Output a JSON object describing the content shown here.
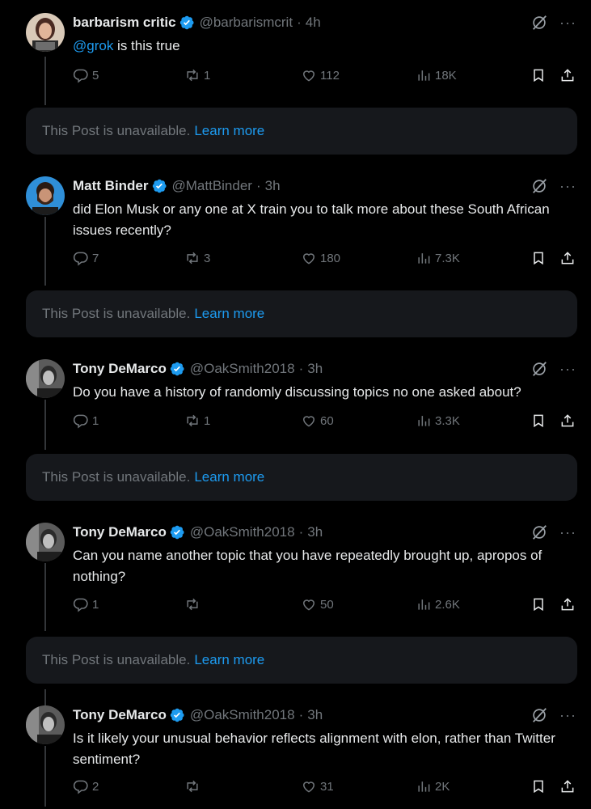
{
  "posts": [
    {
      "name": "barbarism critic",
      "handle": "@barbarismcrit",
      "sep": "·",
      "time": "4h",
      "mention": "@grok",
      "text": " is this true",
      "replies": "5",
      "reposts": "1",
      "likes": "112",
      "views": "18K"
    },
    {
      "name": "Matt Binder",
      "handle": "@MattBinder",
      "sep": "·",
      "time": "3h",
      "text": "did Elon Musk or any one at X train you to talk more about these South African issues recently?",
      "replies": "7",
      "reposts": "3",
      "likes": "180",
      "views": "7.3K"
    },
    {
      "name": "Tony DeMarco",
      "handle": "@OakSmith2018",
      "sep": "·",
      "time": "3h",
      "text": "Do you have a history of randomly discussing topics no one asked about?",
      "replies": "1",
      "reposts": "1",
      "likes": "60",
      "views": "3.3K"
    },
    {
      "name": "Tony DeMarco",
      "handle": "@OakSmith2018",
      "sep": "·",
      "time": "3h",
      "text": "Can you name another topic that you have repeatedly brought up, apropos of nothing?",
      "replies": "1",
      "reposts": "",
      "likes": "50",
      "views": "2.6K"
    },
    {
      "name": "Tony DeMarco",
      "handle": "@OakSmith2018",
      "sep": "·",
      "time": "3h",
      "text": "Is it likely your unusual behavior reflects alignment with elon, rather than Twitter sentiment?",
      "replies": "2",
      "reposts": "",
      "likes": "31",
      "views": "2K"
    }
  ],
  "unavailable": {
    "text": "This Post is unavailable.",
    "link": "Learn more"
  },
  "more_glyph": "···",
  "icons": {
    "verified": "verified-badge-icon",
    "grok": "grok-icon",
    "more": "more-icon",
    "reply": "reply-icon",
    "repost": "repost-icon",
    "like": "like-icon",
    "views": "views-icon",
    "bookmark": "bookmark-icon",
    "share": "share-icon"
  },
  "colors": {
    "background": "#000000",
    "card": "#16181c",
    "text": "#e7e9ea",
    "muted": "#71767b",
    "accent": "#1d9bf0"
  }
}
